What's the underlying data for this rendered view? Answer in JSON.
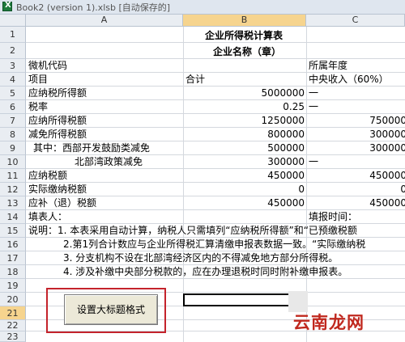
{
  "window": {
    "title": "Book2 (version 1).xlsb [自动保存的]"
  },
  "columns": [
    "A",
    "B",
    "C"
  ],
  "rows": [
    "1",
    "2",
    "3",
    "4",
    "5",
    "6",
    "7",
    "8",
    "9",
    "10",
    "11",
    "12",
    "13",
    "14",
    "15",
    "16",
    "17",
    "18",
    "19",
    "20",
    "21",
    "22",
    "23"
  ],
  "selected": {
    "column": "B",
    "row": "21"
  },
  "cells": {
    "r1_title": "企业所得税计算表",
    "r2_title": "企业名称（章）",
    "r3_a": "微机代码",
    "r3_c": "所属年度",
    "r4_a": "项目",
    "r4_b": "合计",
    "r4_c": "中央收入（60%）",
    "r5_a": "应纳税所得额",
    "r5_b": "5000000",
    "r5_c": "一",
    "r6_a": "税率",
    "r6_b": "0.25",
    "r6_c": "一",
    "r7_a": "应纳所得税额",
    "r7_b": "1250000",
    "r7_c": "750000",
    "r8_a": "减免所得税额",
    "r8_b": "800000",
    "r8_c": "300000",
    "r9_a": "其中：西部开发鼓励类减免",
    "r9_b": "500000",
    "r9_c": "300000",
    "r10_a": "北部湾政策减免",
    "r10_b": "300000",
    "r10_c": "一",
    "r11_a": "应纳税额",
    "r11_b": "450000",
    "r11_c": "450000",
    "r12_a": "实际缴纳税额",
    "r12_b": "0",
    "r12_c": "0",
    "r13_a": "应补（退）税额",
    "r13_b": "450000",
    "r13_c": "450000",
    "r14_a": "填表人：",
    "r14_c": "填报时间：",
    "r15_a": "说明：1. 本表采用自动计算，纳税人只需填列“应纳税所得额”和“已预缴税额",
    "r16_a": "2.第1列合计数应与企业所得税汇算清缴申报表数据一致。“实际缴纳税",
    "r17_a": "3. 分支机构不设在北部湾经济区内的不得减免地方部分所得税。",
    "r18_a": "4. 涉及补缴中央部分税款的，应在办理退税时同时附补缴申报表。"
  },
  "button": {
    "label": "设置大标题格式"
  },
  "watermark": {
    "text": "云南龙网"
  }
}
